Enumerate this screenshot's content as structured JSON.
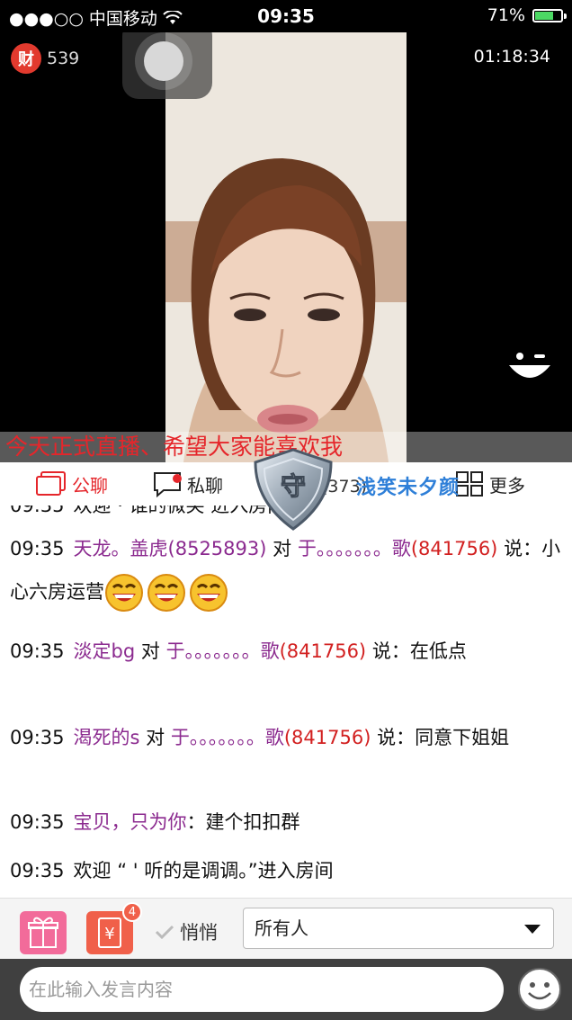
{
  "status_bar": {
    "carrier": "●●●○○ 中国移动",
    "time": "09:35",
    "battery_pct": "71%",
    "battery_level": 0.71
  },
  "video": {
    "coin_icon_label": "财",
    "coin_count": "539",
    "elapsed": "01:18:34",
    "marquee": "今天正式直播、希望大家能喜欢我"
  },
  "tabs": {
    "public": "公聊",
    "private": "私聊",
    "guard_label": "守",
    "partial": "大(373)",
    "highlight_name": "浅笑未夕颜",
    "more": "更多"
  },
  "chat": {
    "messages": [
      {
        "time": "09:35",
        "from": "天龙。盖虎(8525893)",
        "verb": "对",
        "to": "于。。。。。。。歌",
        "to_id": "(841756)",
        "says": "说：",
        "text": "小心六房运营",
        "emojis": 3
      },
      {
        "time": "09:35",
        "from": "淡定bg",
        "verb": "对",
        "to": "于。。。。。。。歌",
        "to_id": "(841756)",
        "says": "说：",
        "text": "在低点"
      },
      {
        "time": "09:35",
        "from": "渴死的s",
        "verb": "对",
        "to": "于。。。。。。。歌",
        "to_id": "(841756)",
        "says": "说：",
        "text": "同意下姐姐"
      },
      {
        "time": "09:35",
        "from": "宝贝，只为你",
        "says": "：",
        "text": "建个扣扣群"
      },
      {
        "time": "09:35",
        "text": "欢迎 “ ' 听的是调调。”进入房间"
      }
    ]
  },
  "actions": {
    "gift_count": "4",
    "yuan_label": "¥",
    "quiet_label": "悄悄",
    "recipient": "所有人"
  },
  "input": {
    "placeholder": "在此输入发言内容"
  },
  "colors": {
    "accent_red": "#e5262b",
    "name_purple": "#8b2a8f",
    "highlight_blue": "#2e7fd8"
  }
}
